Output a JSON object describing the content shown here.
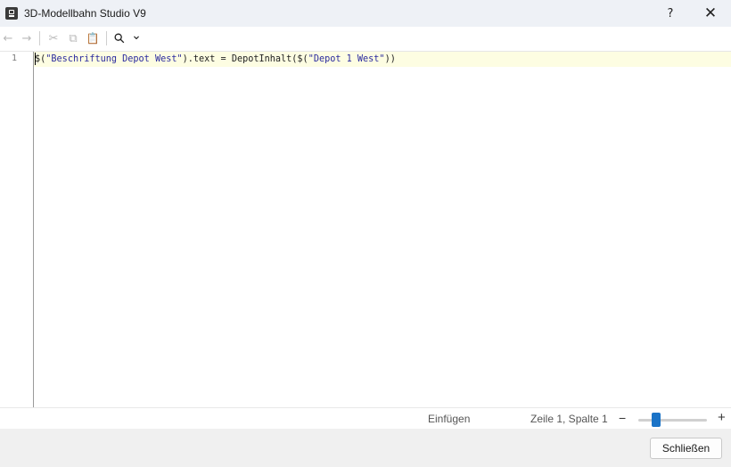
{
  "window": {
    "title": "3D-Modellbahn Studio V9",
    "app_icon": "app-icon",
    "help_label": "?",
    "close_label": "✕"
  },
  "toolbar": {
    "items": [
      {
        "name": "back-icon",
        "glyph": "←",
        "enabled": false
      },
      {
        "name": "forward-icon",
        "glyph": "→",
        "enabled": false
      },
      {
        "name": "cut-icon",
        "glyph": "✂",
        "enabled": false
      },
      {
        "name": "copy-icon",
        "glyph": "⧉",
        "enabled": false
      },
      {
        "name": "paste-icon",
        "glyph": "📋",
        "enabled": true
      },
      {
        "name": "search-icon",
        "glyph": "⚲",
        "enabled": true
      },
      {
        "name": "chevron-down-icon",
        "glyph": "⌄",
        "enabled": true
      }
    ]
  },
  "editor": {
    "lines": [
      {
        "number": "1",
        "tokens": [
          {
            "text": "$(",
            "type": "plain"
          },
          {
            "text": "\"Beschriftung Depot West\"",
            "type": "string"
          },
          {
            "text": ").text = DepotInhalt($(",
            "type": "plain"
          },
          {
            "text": "\"Depot 1 West\"",
            "type": "string"
          },
          {
            "text": "))",
            "type": "plain"
          }
        ]
      }
    ]
  },
  "status": {
    "mode": "Einfügen",
    "position": "Zeile 1, Spalte 1",
    "zoom_minus": "−",
    "zoom_plus": "+",
    "zoom_level": 0.25
  },
  "footer": {
    "close_button": "Schließen"
  },
  "colors": {
    "accent": "#1a73c7",
    "string": "#2a2a9e",
    "current_line": "#fdfde2"
  }
}
